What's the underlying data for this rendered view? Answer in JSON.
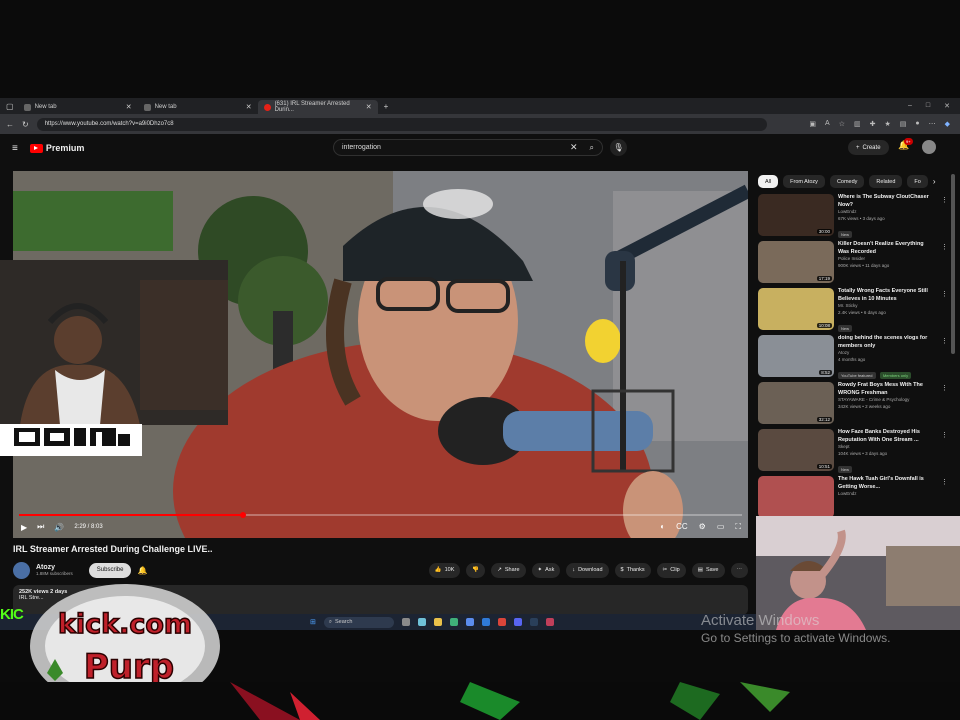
{
  "browser": {
    "tabs": [
      {
        "label": "New tab",
        "active": false
      },
      {
        "label": "New tab",
        "active": false
      },
      {
        "label": "(631) IRL Streamer Arrested Durin...",
        "active": true
      }
    ],
    "url": "https://www.youtube.com/watch?v=a9i0Dhzo7c8",
    "window_controls": [
      "–",
      "□",
      "✕"
    ]
  },
  "youtube": {
    "logo_text": "Premium",
    "search_value": "interrogation",
    "create_label": "Create",
    "notif_count": "9+",
    "video": {
      "time": "2:29 / 8:03",
      "progress": 0.31,
      "title": "IRL Streamer Arrested During Challenge LIVE..",
      "channel": "Atozy",
      "subscribers": "1.88M subscribers",
      "subscribe_label": "Subscribe",
      "likes": "10K",
      "actions": [
        "Share",
        "Ask",
        "Download",
        "Thanks",
        "Clip",
        "Save"
      ],
      "views_line": "252K views  2 days",
      "desc_line": "IRL Stre..."
    },
    "chips": [
      "All",
      "From Atozy",
      "Comedy",
      "Related",
      "Fo"
    ],
    "recommendations": [
      {
        "title": "Where is The Subway CloutChaser Now?",
        "channel": "LowEndz",
        "views": "67K views • 3 days ago",
        "badge": "New",
        "duration": "30:00",
        "color": "#3a2a22"
      },
      {
        "title": "Killer Doesn't Realize Everything Was Recorded",
        "channel": "Police Insider",
        "views": "900K views • 11 days ago",
        "badge": "",
        "duration": "17:19",
        "color": "#7a6a5a"
      },
      {
        "title": "Totally Wrong Facts Everyone Still Believes in 10 Minutes",
        "channel": "Mr. Sticky",
        "views": "2.4K views • 6 days ago",
        "badge": "New",
        "duration": "10:08",
        "color": "#c8b060"
      },
      {
        "title": "doing behind the scenes vlogs for members only",
        "channel": "Atozy",
        "views": "4 months ago",
        "badge": "YouTube featured",
        "badge2": "Members only",
        "duration": "8:52",
        "color": "#8a8f96"
      },
      {
        "title": "Rowdy Frat Boys Mess With The WRONG Freshman",
        "channel": "STAYAWARE - Crime & Psychology",
        "views": "342K views • 2 weeks ago",
        "badge": "",
        "duration": "32:12",
        "color": "#6b6055"
      },
      {
        "title": "How Faze Banks Destroyed His Reputation With One Stream ...",
        "channel": "Skept",
        "views": "104K views • 3 days ago",
        "badge": "New",
        "duration": "10:51",
        "color": "#5a4a40"
      },
      {
        "title": "The Hawk Tuah Girl's Downfall is Getting Worse...",
        "channel": "LowEndz",
        "views": "",
        "badge": "",
        "duration": "",
        "color": "#b05050"
      }
    ]
  },
  "overlay": {
    "cam_logo_text": "Kick",
    "kick_text": "KIC",
    "brand_line1": "kick.com",
    "brand_line2": "Purp"
  },
  "taskbar": {
    "search_label": "Search"
  },
  "watermark": {
    "line1": "Activate Windows",
    "line2": "Go to Settings to activate Windows."
  }
}
